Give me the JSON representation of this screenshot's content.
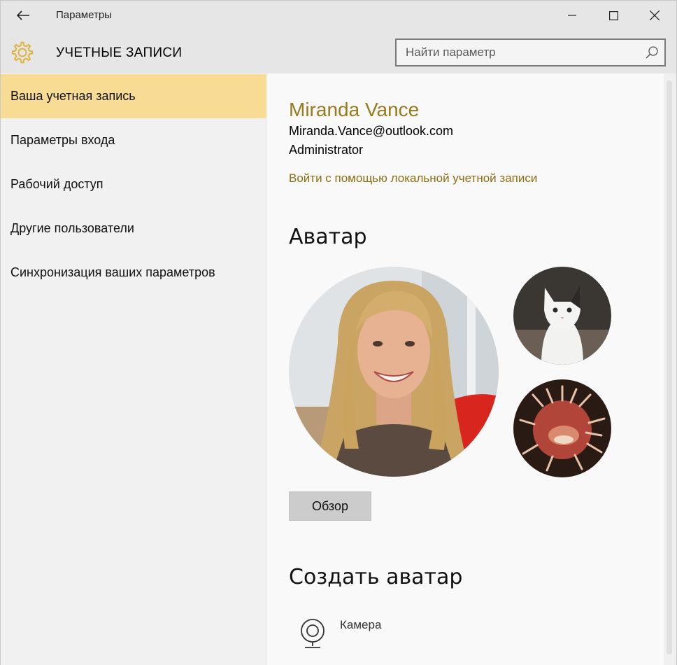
{
  "window": {
    "app_title": "Параметры",
    "controls": {
      "minimize": "minimize-icon",
      "maximize": "maximize-icon",
      "close": "close-icon"
    }
  },
  "header": {
    "title": "УЧЕТНЫЕ ЗАПИСИ",
    "icon": "gear-icon",
    "search_placeholder": "Найти параметр"
  },
  "sidebar": {
    "items": [
      {
        "label": "Ваша учетная запись",
        "active": true
      },
      {
        "label": "Параметры входа",
        "active": false
      },
      {
        "label": "Рабочий доступ",
        "active": false
      },
      {
        "label": "Другие пользователи",
        "active": false
      },
      {
        "label": "Синхронизация ваших параметров",
        "active": false
      }
    ]
  },
  "account": {
    "name": "Miranda Vance",
    "email": "Miranda.Vance@outlook.com",
    "role": "Administrator",
    "local_account_link": "Войти с помощью локальной учетной записи"
  },
  "avatar_section": {
    "heading": "Аватар",
    "browse_label": "Обзор"
  },
  "create_section": {
    "heading": "Создать аватар",
    "camera_label": "Камера"
  },
  "colors": {
    "accent": "#9a7a1f",
    "active_nav": "#f8dc93",
    "link": "#8c6d12"
  }
}
